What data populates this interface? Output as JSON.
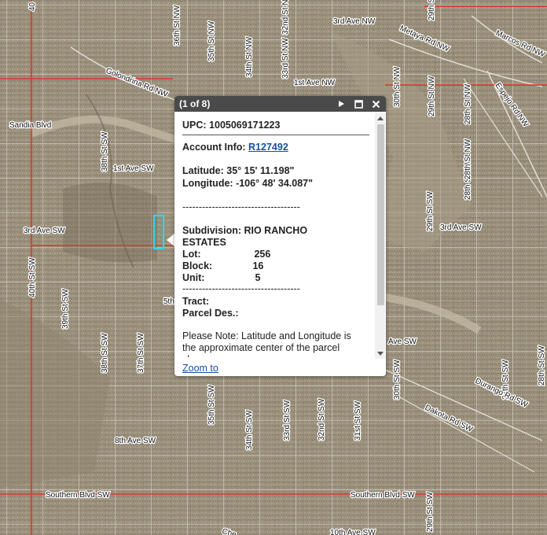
{
  "popup": {
    "title": "(1 of 8)",
    "upc_label": "UPC:",
    "upc_value": "1005069171223",
    "account_label": "Account Info:",
    "account_value": "R127492",
    "latitude_label": "Latitude:",
    "latitude_value": "35° 15' 11.198\"",
    "longitude_label": "Longitude:",
    "longitude_value": "-106° 48' 34.087\"",
    "separator": "------------------------------------",
    "subdivision_label": "Subdivision:",
    "subdivision_value_1": "RIO RANCHO",
    "subdivision_value_2": "ESTATES",
    "lot_label": "Lot:",
    "lot_value": "256",
    "block_label": "Block:",
    "block_value": "16",
    "unit_label": "Unit:",
    "unit_value": "5",
    "tract_label": "Tract:",
    "parcel_label": "Parcel Des.:",
    "note_1": "Please Note: Latitude and Longitude is",
    "note_2": "the approximate center of the parcel",
    "note_3": "shown",
    "zoom_to": "Zoom to"
  },
  "map": {
    "streets": {
      "third_ave_nw": "3rd Ave NW",
      "first_ave_nw": "1st Ave NW",
      "marcos_rd_nw": "Marcos Rd NW",
      "metaya_rd_nw": "Metaya Rd NW",
      "espejo_rd_nw": "Espejo Rd NW",
      "golondrina_rd_nw": "Golondrina Rd NW",
      "sandia_blvd": "Sandia Blvd",
      "first_ave_sw": "1st Ave SW",
      "third_ave_sw_w": "3rd Ave SW",
      "third_ave_sw_e": "3rd Ave SW",
      "fortieth_st_sw": "40th St SW",
      "thirty_eighth_st_sw": "38th St SW",
      "thirty_eighth_st_sw_2": "38th St SW",
      "thirty_ninth_st_sw": "39th St SW",
      "thirty_seventh_st_sw": "37th St SW",
      "thirty_fifth_st_sw": "35th St SW",
      "thirty_fourth_st_sw": "34th St SW",
      "thirty_third_st_sw": "33rd St SW",
      "thirty_second_st_sw": "32nd St SW",
      "thirty_first_st_sw": "31st St SW",
      "thirtieth_st_sw": "30th St SW",
      "twenty_ninth_st_sw": "29th St SW",
      "twenty_eighth_st_sw": "28th St SW",
      "twenty_eighth_st_sw_2": "28th St SW",
      "twenty_seventh_st_sw": "27th St SW",
      "thirty_sixth_st_nw": "36th St NW",
      "thirty_fifth_st_nw": "35th St NW",
      "thirty_fourth_st_nw": "34th St NW",
      "thirty_third_st_nw": "33rd St NW",
      "thirty_second_st_nw": "32nd St NW",
      "thirtieth_st_nw": "30th St NW",
      "twenty_ninth_st_nw": "29th St NW",
      "twenty_eighth_st_nw": "28th St NW",
      "twenty_ninth_st_nw_2": "29th St NW",
      "twenty_eighth_st_nw_2": "28th St NW",
      "twenty_seventh_st_nw": "27th St NW",
      "fifth_ave_fragment": "5th",
      "ave_sw_fragment": "Ave SW",
      "eighth_ave_sw": "8th Ave SW",
      "southern_blvd_sw_w": "Southern Blvd SW",
      "southern_blvd_sw_e": "Southern Blvd SW",
      "durango_rd_sw": "Durango Rd SW",
      "dakota_rd_sw": "Dakota Rd SW",
      "tenth_ave_sw": "10th Ave SW",
      "chess_fragment": "Che",
      "forty_fragment": "40"
    }
  }
}
